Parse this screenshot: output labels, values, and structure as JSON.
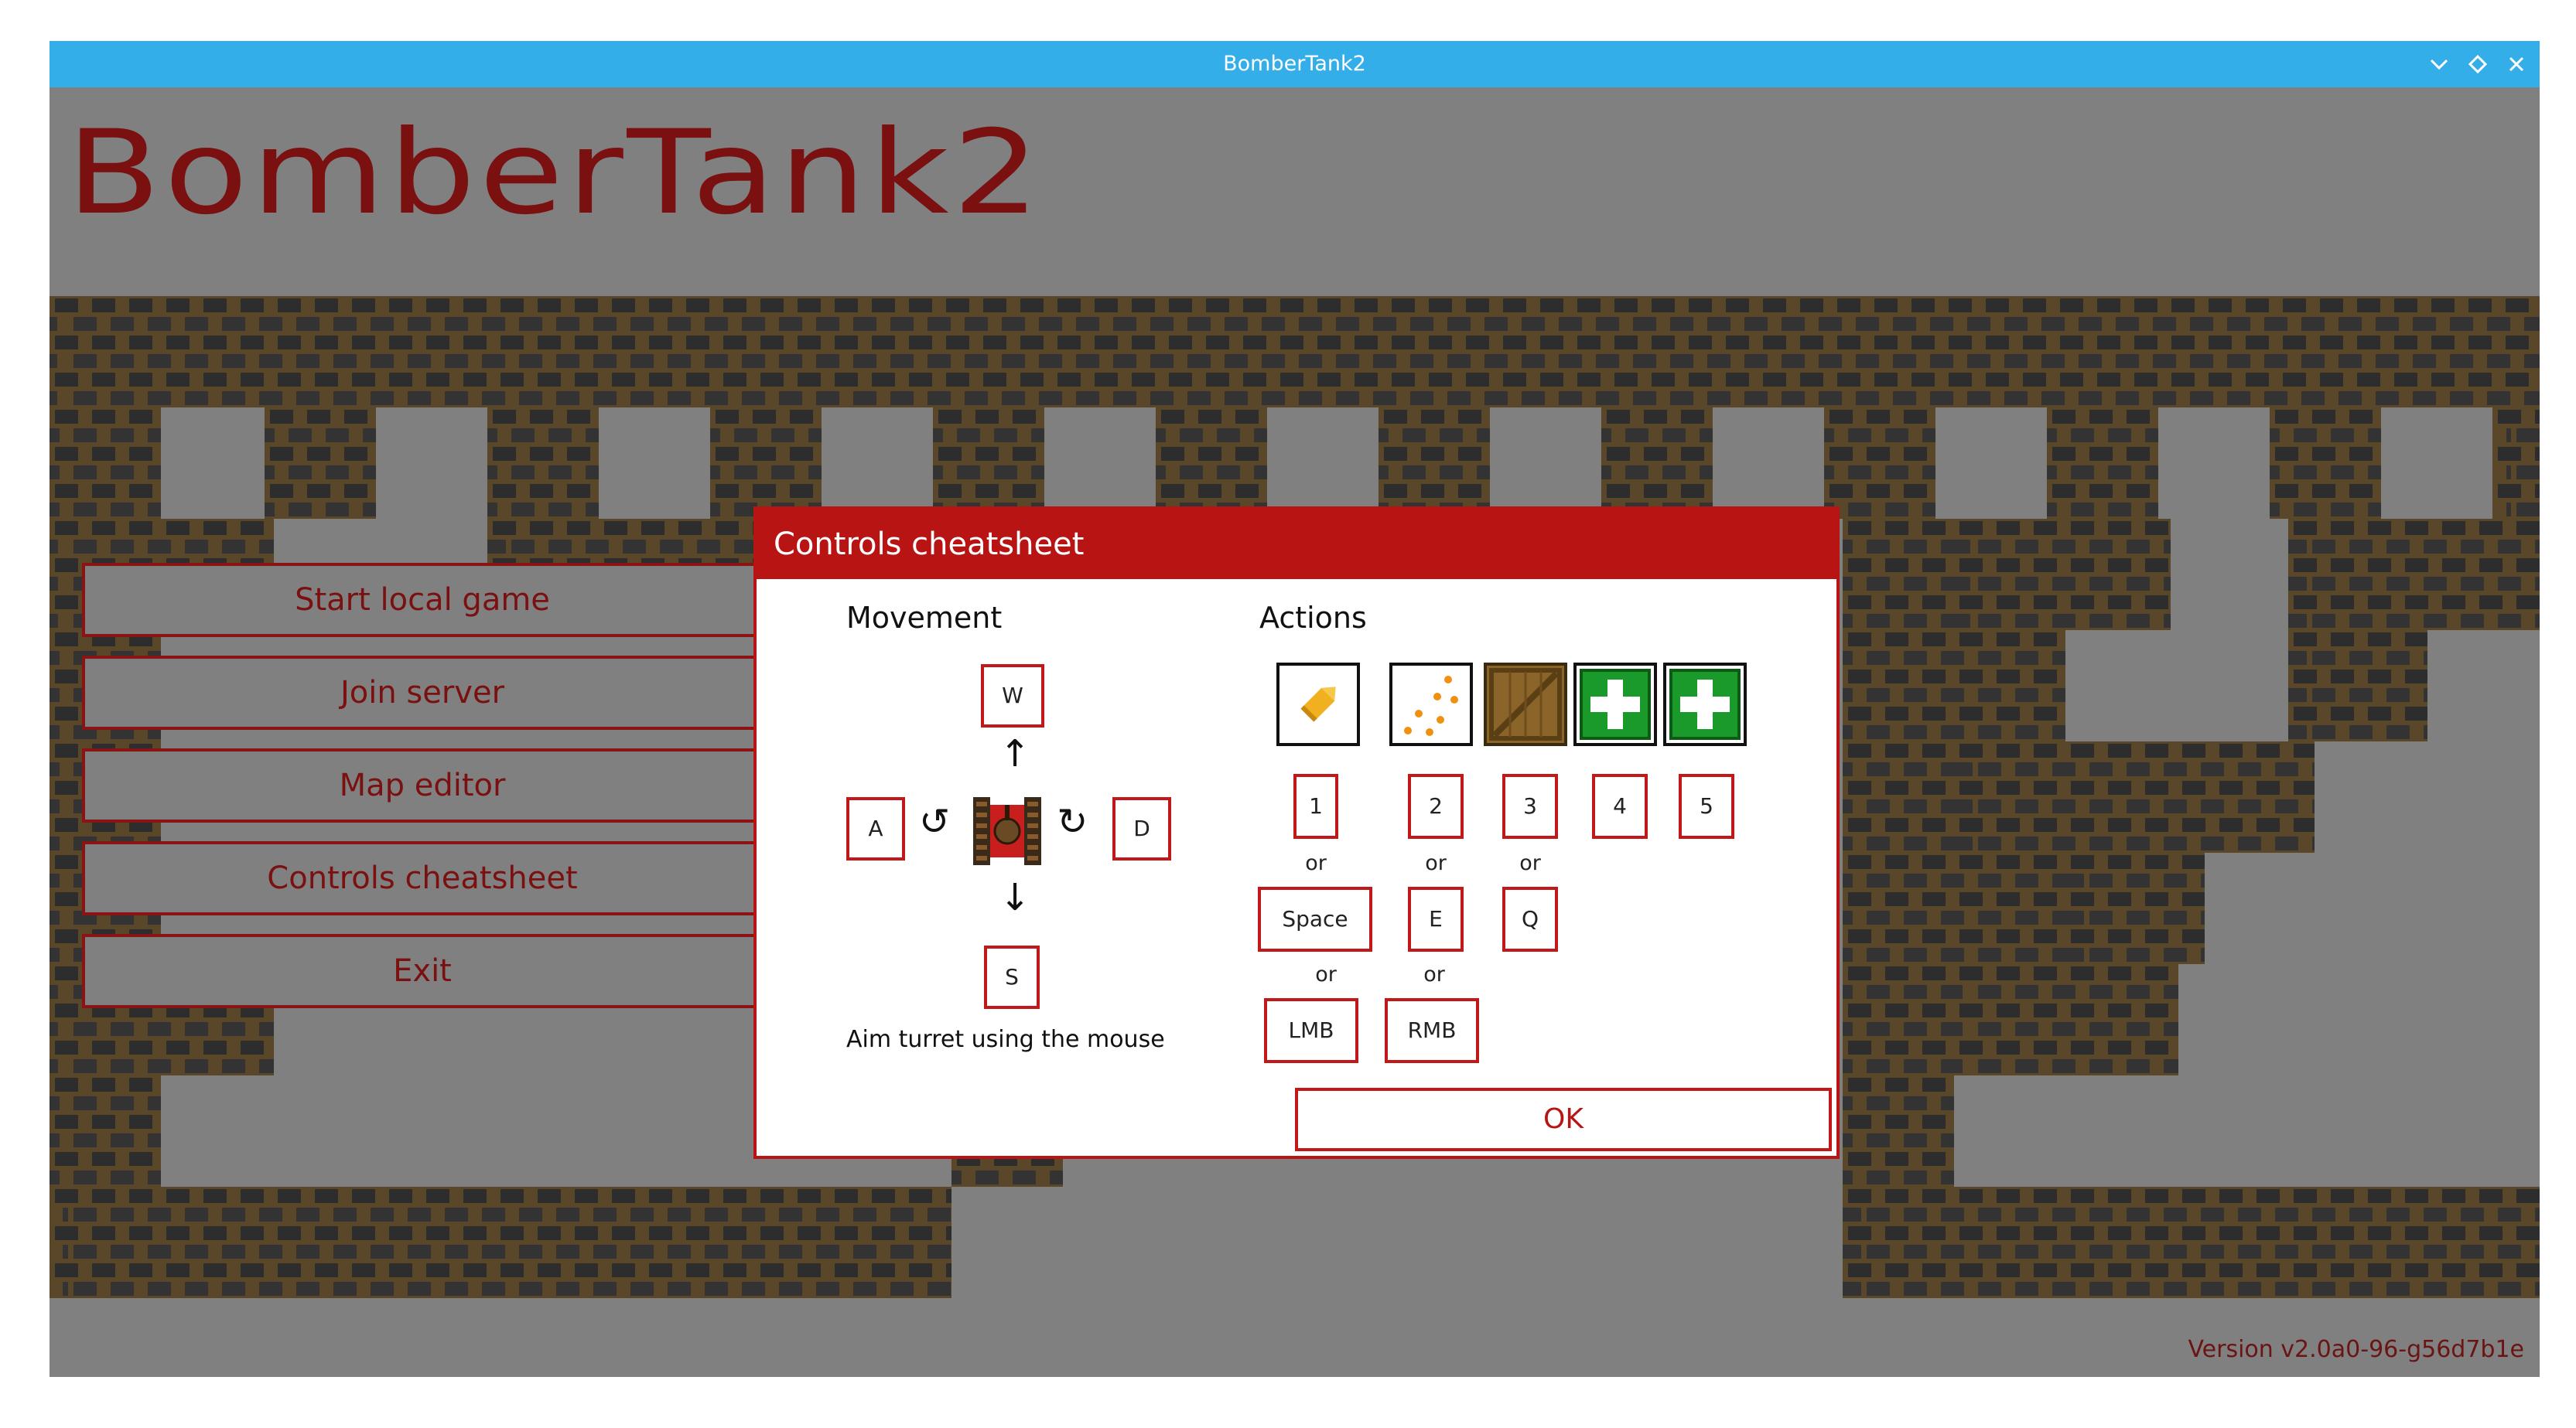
{
  "window": {
    "title": "BomberTank2",
    "controls": [
      "minimize-icon",
      "maximize-icon",
      "close-icon"
    ]
  },
  "game": {
    "logo": "BomberTank2",
    "menu": [
      "Start local game",
      "Join server",
      "Map editor",
      "Controls cheatsheet",
      "Exit"
    ],
    "version": "Version v2.0a0-96-g56d7b1e"
  },
  "dialog": {
    "title": "Controls cheatsheet",
    "movement": {
      "heading": "Movement",
      "keys": {
        "up": "W",
        "left": "A",
        "right": "D",
        "down": "S"
      },
      "aim_text": "Aim turret using the mouse"
    },
    "actions": {
      "heading": "Actions",
      "slots": [
        "bullet-icon",
        "shotgun-pellets-icon",
        "crate-icon",
        "health-pack-icon",
        "health-pack-icon"
      ],
      "numbers": [
        "1",
        "2",
        "3",
        "4",
        "5"
      ],
      "alt1": [
        "Space",
        "E",
        "Q"
      ],
      "alt2": [
        "LMB",
        "RMB"
      ],
      "or": "or"
    },
    "ok": "OK"
  },
  "colors": {
    "titlebar": "#33aee8",
    "accent": "#b81414",
    "background": "#808080",
    "logo": "#7a1010"
  }
}
